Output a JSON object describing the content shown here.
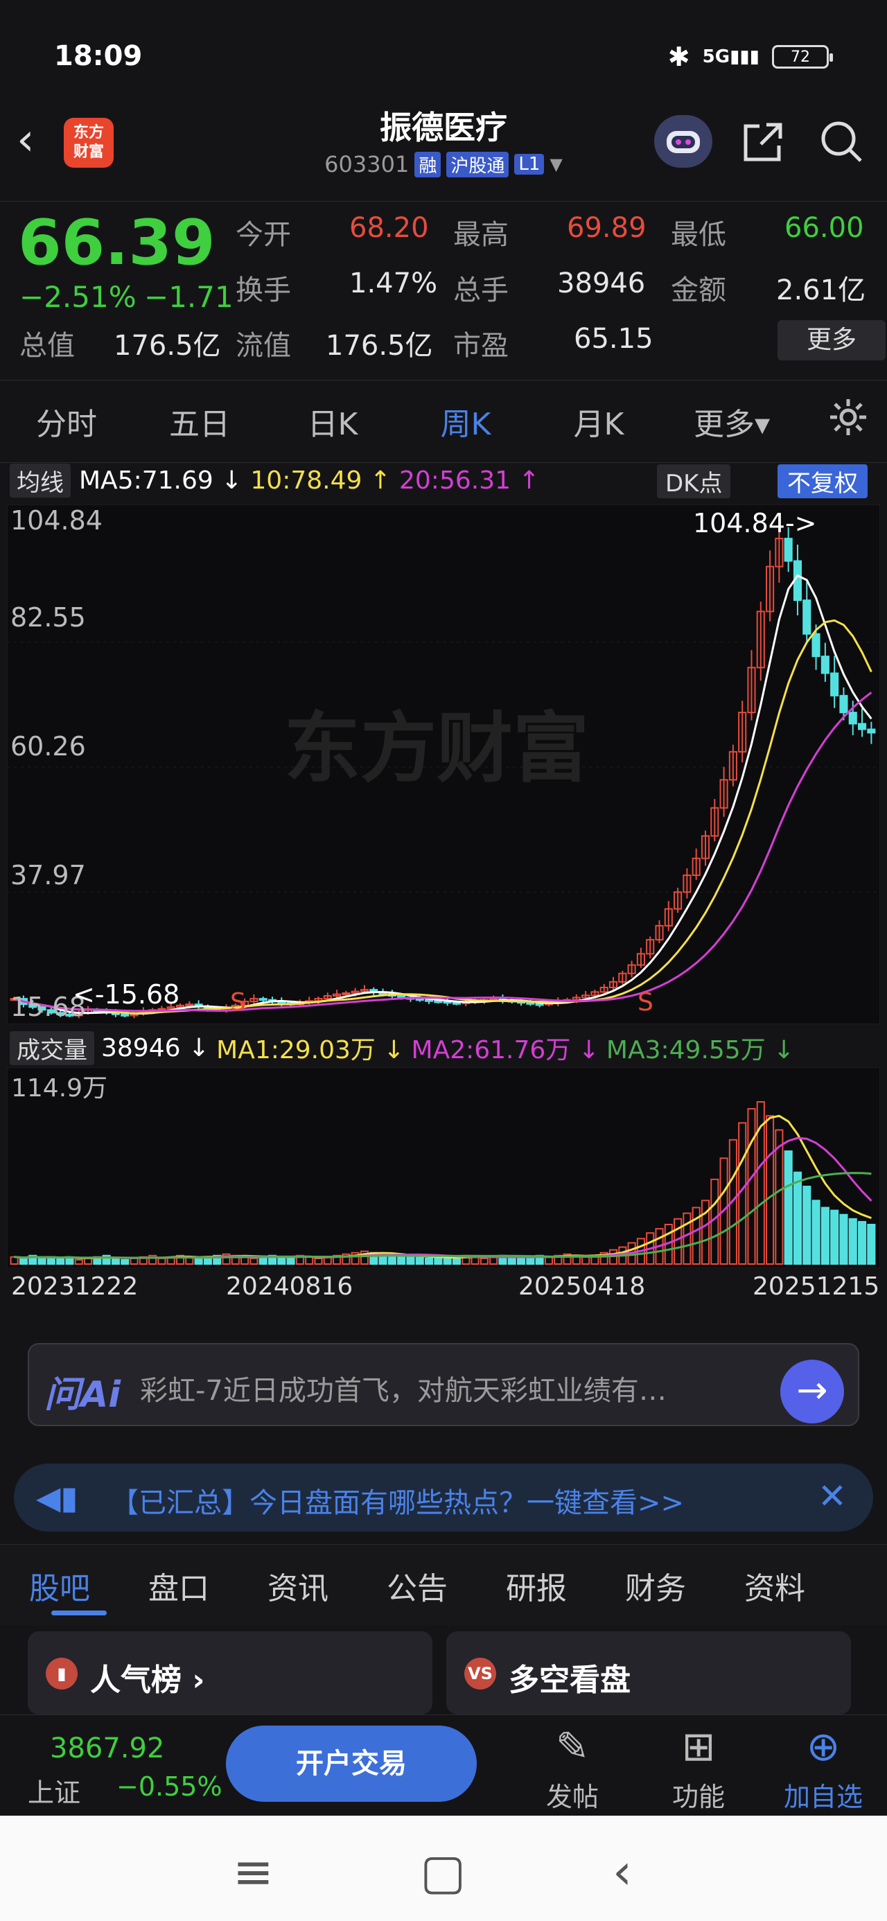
{
  "status": {
    "time": "18:09",
    "battery": "72",
    "network": "5G"
  },
  "header": {
    "title": "振德医疗",
    "code": "603301",
    "tags": [
      "融",
      "沪股通",
      "L1"
    ],
    "logo_text": "东方财富"
  },
  "quote": {
    "price": "66.39",
    "pct": "−2.51%",
    "chg": "−1.71",
    "open_label": "今开",
    "open": "68.20",
    "high_label": "最高",
    "high": "69.89",
    "low_label": "最低",
    "low": "66.00",
    "turnover_label": "换手",
    "turnover": "1.47%",
    "volume_label": "总手",
    "volume": "38946",
    "amount_label": "金额",
    "amount": "2.61亿",
    "mktcap_label": "总值",
    "mktcap": "176.5亿",
    "float_label": "流值",
    "float": "176.5亿",
    "pe_label": "市盈",
    "pe": "65.15",
    "more": "更多"
  },
  "tabs": [
    {
      "label": "分时"
    },
    {
      "label": "五日"
    },
    {
      "label": "日K"
    },
    {
      "label": "周K"
    },
    {
      "label": "月K"
    },
    {
      "label": "更多▾"
    }
  ],
  "ma_legend": {
    "chip": "均线",
    "ma5": "MA5:71.69 ↓",
    "ma10": "10:78.49 ↑",
    "ma20": "20:56.31 ↑",
    "dk": "DK点",
    "fq": "不复权"
  },
  "price_axis": [
    "104.84",
    "82.55",
    "60.26",
    "37.97",
    "15.68"
  ],
  "price_annot": {
    "high": "104.84->",
    "low": "<-15.68",
    "sell_marker": "S"
  },
  "watermark": "东方财富",
  "vol_legend": {
    "chip": "成交量",
    "vol": "38946 ↓",
    "ma1": "MA1:29.03万 ↓",
    "ma2": "MA2:61.76万 ↓",
    "ma3": "MA3:49.55万 ↓",
    "max": "114.9万"
  },
  "dates": [
    "20231222",
    "20240816",
    "20250418",
    "20251215"
  ],
  "ai": {
    "logo": "问Ai",
    "text": "彩虹-7近日成功首飞，对航天彩虹业绩有…"
  },
  "notice": {
    "text": "【已汇总】今日盘面有哪些热点？一键查看>>"
  },
  "subtabs": [
    {
      "label": "股吧"
    },
    {
      "label": "盘口"
    },
    {
      "label": "资讯"
    },
    {
      "label": "公告"
    },
    {
      "label": "研报"
    },
    {
      "label": "财务"
    },
    {
      "label": "资料"
    }
  ],
  "cards": [
    {
      "title": "人气榜 ›"
    },
    {
      "title": "多空看盘"
    }
  ],
  "bottom": {
    "index_value": "3867.92",
    "index_name": "上证",
    "index_chg": "−0.55%",
    "trade": "开户交易",
    "post": "发帖",
    "func": "功能",
    "add": "加自选"
  },
  "colors": {
    "up": "#e74c3c",
    "down": "#3fcf3f",
    "accent": "#4a82e8",
    "ma5": "#ffffff",
    "ma10": "#f5e04a",
    "ma20": "#d43fd4",
    "vol_ma3": "#4caf50"
  },
  "chart_data": {
    "type": "candlestick",
    "title": "",
    "price_range": [
      15.68,
      104.84
    ],
    "volume_max": 114.9,
    "closes": [
      19,
      18,
      17.5,
      17,
      16.5,
      16.2,
      16,
      16.5,
      17,
      16.8,
      16.5,
      16.2,
      16,
      16.3,
      16.8,
      17,
      17.2,
      17.5,
      17.8,
      18,
      17.6,
      17.2,
      17,
      17.3,
      17.8,
      18.5,
      19,
      18.8,
      18.5,
      18.2,
      18,
      18.3,
      18.6,
      19,
      19.5,
      19.8,
      20,
      20.3,
      20.6,
      20.2,
      19.8,
      19.5,
      19.2,
      19,
      18.8,
      18.6,
      18.5,
      18.3,
      18.2,
      18.4,
      18.6,
      18.8,
      19,
      18.7,
      18.5,
      18.3,
      18.1,
      18,
      18.2,
      18.5,
      18.8,
      19.2,
      19.6,
      20.2,
      21,
      22,
      23.5,
      25,
      27,
      29.5,
      32,
      35,
      38,
      41,
      44,
      48,
      53,
      58,
      63,
      70,
      78,
      88,
      96,
      101,
      97,
      90,
      84,
      80,
      77,
      73,
      70,
      68,
      67,
      66.39
    ],
    "volumes": [
      5,
      4,
      6,
      4,
      5,
      4,
      5,
      3,
      4,
      5,
      6,
      4,
      3,
      4,
      5,
      6,
      4,
      5,
      6,
      5,
      4,
      5,
      6,
      7,
      6,
      5,
      4,
      5,
      6,
      5,
      4,
      6,
      5,
      4,
      5,
      6,
      7,
      8,
      9,
      8,
      7,
      6,
      5,
      6,
      5,
      4,
      5,
      4,
      5,
      6,
      5,
      4,
      5,
      6,
      5,
      4,
      5,
      6,
      5,
      6,
      7,
      6,
      5,
      6,
      8,
      10,
      12,
      15,
      18,
      22,
      25,
      28,
      32,
      36,
      40,
      45,
      60,
      75,
      88,
      100,
      110,
      114.9,
      105,
      95,
      80,
      65,
      55,
      45,
      40,
      38,
      35,
      32,
      30,
      28
    ],
    "ma_lines": [
      "MA5",
      "MA10",
      "MA20"
    ]
  }
}
